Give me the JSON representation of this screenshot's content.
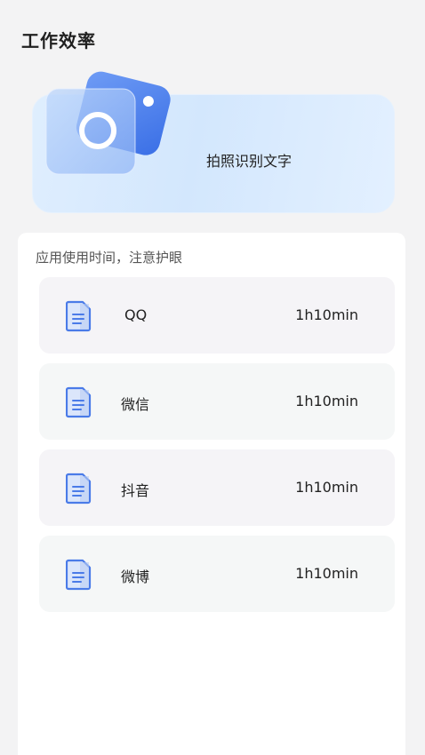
{
  "page": {
    "title": "工作效率"
  },
  "ocr_card": {
    "label": "拍照识别文字",
    "icon": "camera-icon"
  },
  "usage": {
    "caption": "应用使用时间，注意护眼",
    "item_icon": "document-icon",
    "items": [
      {
        "name": "QQ",
        "time": "1h10min"
      },
      {
        "name": "微信",
        "time": "1h10min"
      },
      {
        "name": "抖音",
        "time": "1h10min"
      },
      {
        "name": "微博",
        "time": "1h10min"
      }
    ]
  },
  "colors": {
    "accent_blue": "#4a7be8",
    "card_gradient_start": "#dfeefe",
    "card_gradient_end": "#e3f0ff",
    "row_bg": "#f5f6f7"
  }
}
